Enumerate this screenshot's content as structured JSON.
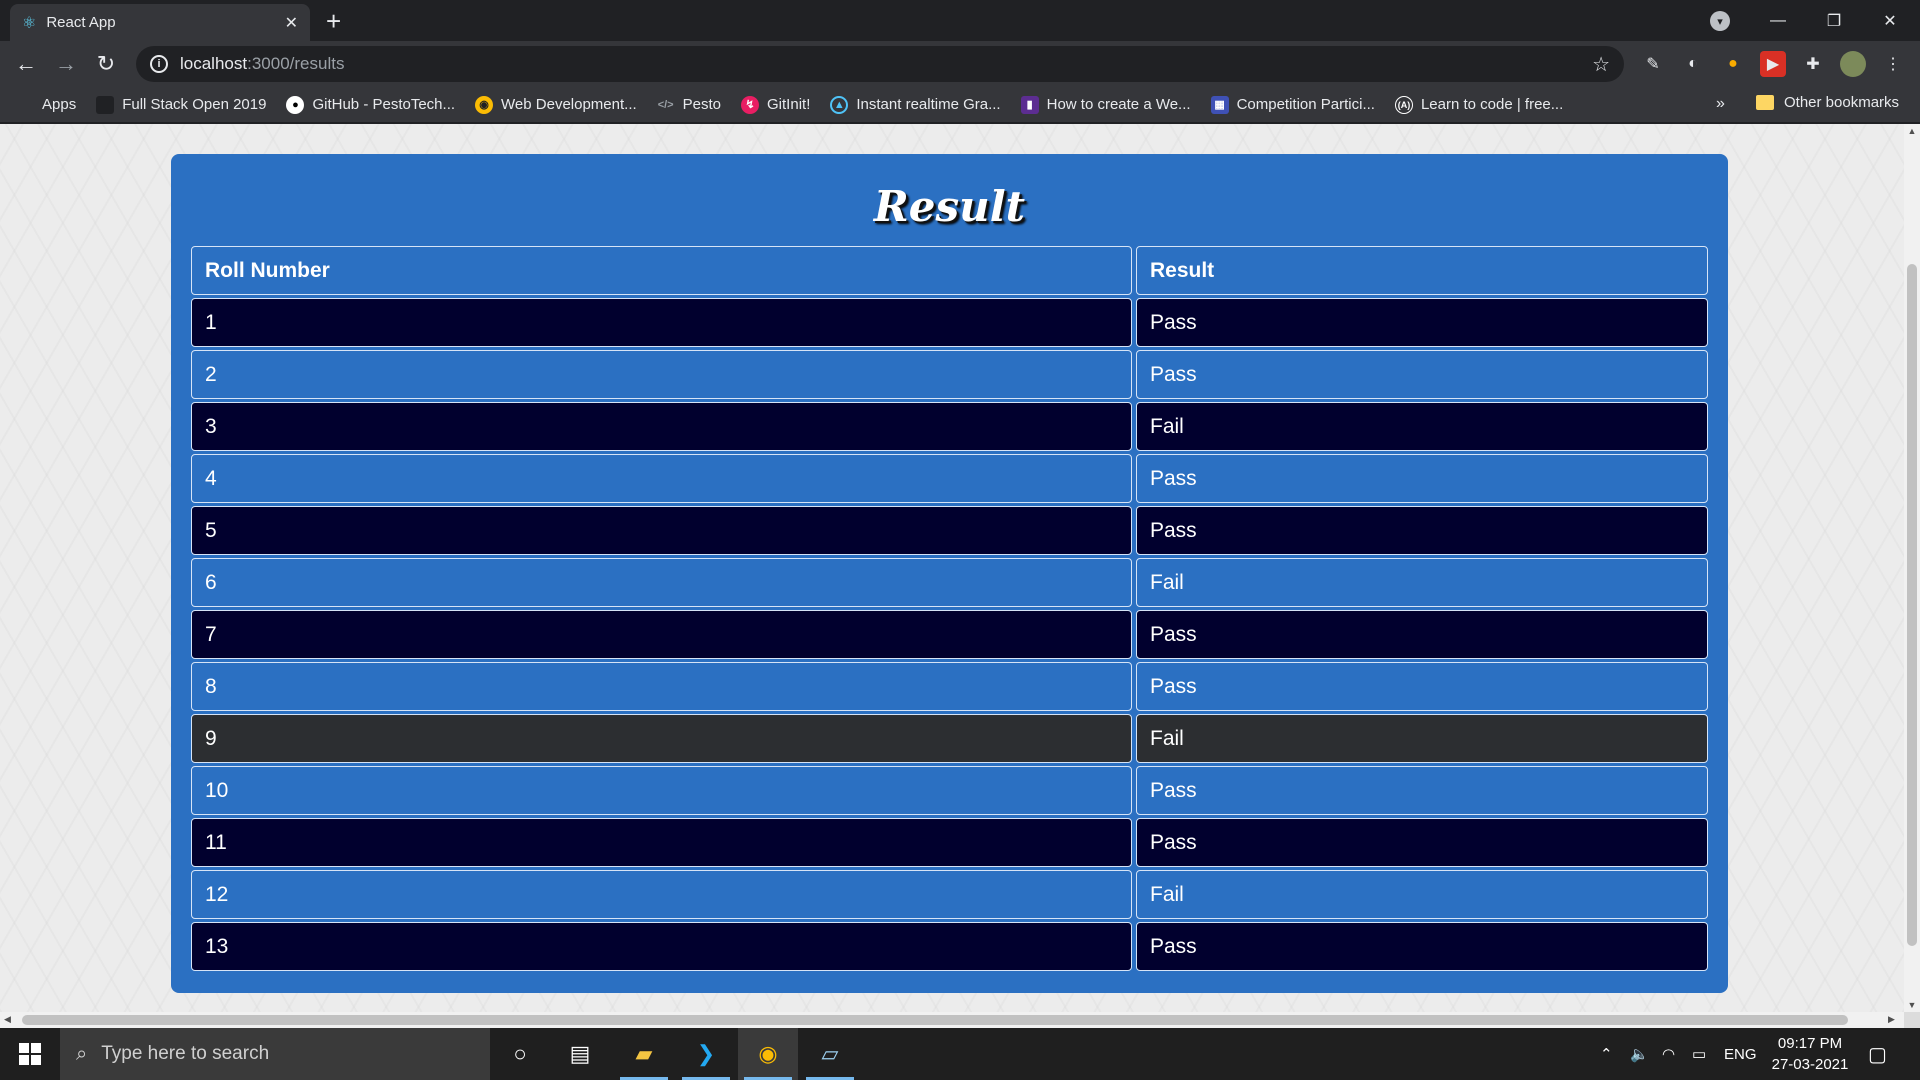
{
  "browser": {
    "tab_title": "React App",
    "tab_close": "✕",
    "new_tab": "+",
    "url_host": "localhost",
    "url_path": ":3000/results",
    "window_controls": [
      "—",
      "❐",
      "✕"
    ]
  },
  "bookmarks": [
    {
      "label": "Apps",
      "icon": "apps-icon",
      "color": "#ea4335"
    },
    {
      "label": "Full Stack Open 2019",
      "icon": "page-icon",
      "color": "#202124"
    },
    {
      "label": "GitHub - PestoTech...",
      "icon": "github-icon",
      "color": "#ffffff"
    },
    {
      "label": "Web Development...",
      "icon": "web-icon",
      "color": "#fbbc04"
    },
    {
      "label": "Pesto",
      "icon": "code-icon",
      "color": "#9aa0a6"
    },
    {
      "label": "GitInit!",
      "icon": "gitinit-icon",
      "color": "#e91e63"
    },
    {
      "label": "Instant realtime Gra...",
      "icon": "shield-icon",
      "color": "#4fc3f7"
    },
    {
      "label": "How to create a We...",
      "icon": "bookmark-icon",
      "color": "#5c2d91"
    },
    {
      "label": "Competition Partici...",
      "icon": "calendar-icon",
      "color": "#3f51b5"
    },
    {
      "label": "Learn to code | free...",
      "icon": "freecodecamp-icon",
      "color": "#ffffff"
    }
  ],
  "bookmarks_more": "»",
  "other_bookmarks": "Other bookmarks",
  "page": {
    "title": "Result",
    "headers": [
      "Roll Number",
      "Result"
    ],
    "rows": [
      {
        "roll": "1",
        "result": "Pass"
      },
      {
        "roll": "2",
        "result": "Pass"
      },
      {
        "roll": "3",
        "result": "Fail"
      },
      {
        "roll": "4",
        "result": "Pass"
      },
      {
        "roll": "5",
        "result": "Pass"
      },
      {
        "roll": "6",
        "result": "Fail"
      },
      {
        "roll": "7",
        "result": "Pass"
      },
      {
        "roll": "8",
        "result": "Pass"
      },
      {
        "roll": "9",
        "result": "Fail"
      },
      {
        "roll": "10",
        "result": "Pass"
      },
      {
        "roll": "11",
        "result": "Pass"
      },
      {
        "roll": "12",
        "result": "Fail"
      },
      {
        "roll": "13",
        "result": "Pass"
      }
    ],
    "colors": {
      "card": "#2b70c2",
      "dark_row": "#01002e",
      "hover_row": "#2c2e31"
    }
  },
  "taskbar": {
    "search_placeholder": "Type here to search",
    "language": "ENG",
    "time": "09:17 PM",
    "date": "27-03-2021"
  }
}
